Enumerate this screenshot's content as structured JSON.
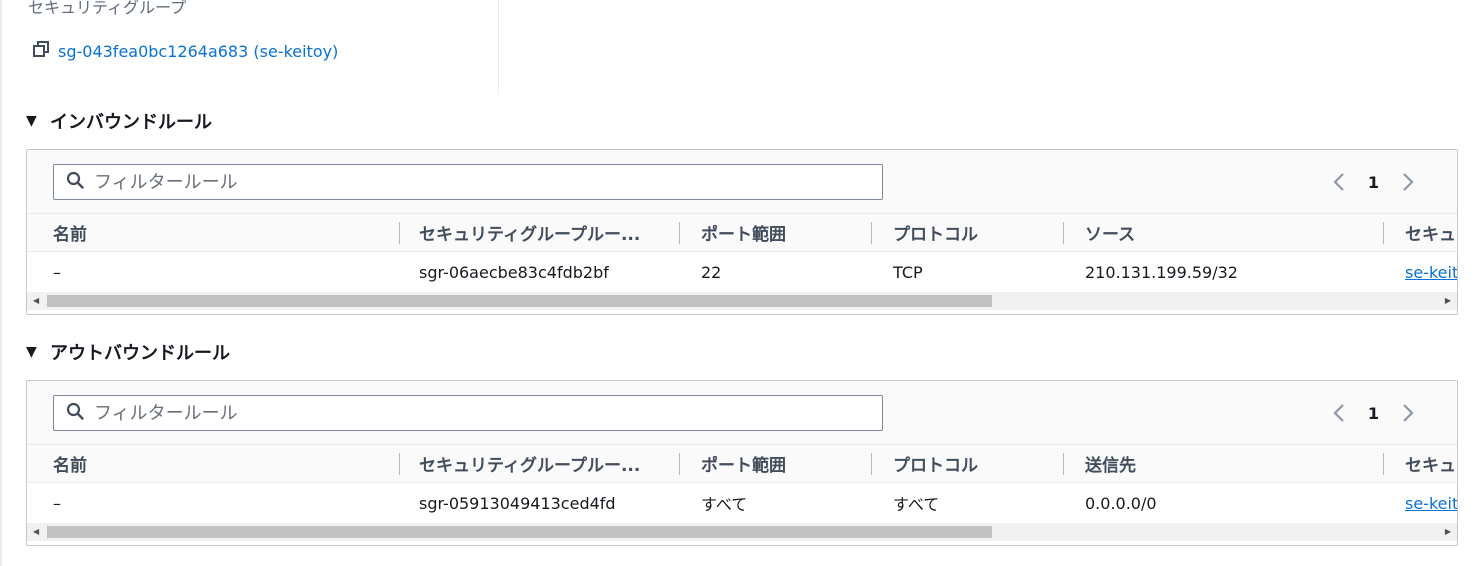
{
  "security_group": {
    "label": "セキュリティグループ",
    "link_text": "sg-043fea0bc1264a683 (se-keitoy)",
    "icon": "copy-icon"
  },
  "inbound": {
    "title": "インバウンドルール",
    "search_placeholder": "フィルタールール",
    "page": "1",
    "columns": [
      "名前",
      "セキュリティグループルー...",
      "ポート範囲",
      "プロトコル",
      "ソース",
      "セキュ"
    ],
    "rows": [
      {
        "name": "–",
        "rule_id": "sgr-06aecbe83c4fdb2bf",
        "port": "22",
        "protocol": "TCP",
        "source": "210.131.199.59/32",
        "sg": "se-keit"
      }
    ]
  },
  "outbound": {
    "title": "アウトバウンドルール",
    "search_placeholder": "フィルタールール",
    "page": "1",
    "columns": [
      "名前",
      "セキュリティグループルー...",
      "ポート範囲",
      "プロトコル",
      "送信先",
      "セキュ"
    ],
    "rows": [
      {
        "name": "–",
        "rule_id": "sgr-05913049413ced4fd",
        "port": "すべて",
        "protocol": "すべて",
        "source": "0.0.0.0/0",
        "sg": "se-keit"
      }
    ]
  },
  "colors": {
    "link": "#0972d3",
    "header_text": "#414d5c",
    "border": "#c6c6cd"
  }
}
